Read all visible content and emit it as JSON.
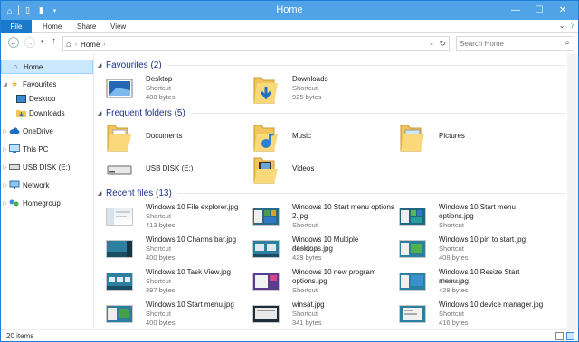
{
  "window": {
    "title": "Home",
    "controls": {
      "minimize": "—",
      "maximize": "☐",
      "close": "✕"
    }
  },
  "ribbon": {
    "tabs": [
      "File",
      "Home",
      "Share",
      "View"
    ]
  },
  "address": {
    "path_root": "⌂",
    "path_label": "Home",
    "search_placeholder": "Search Home"
  },
  "nav": {
    "items": [
      {
        "label": "Home",
        "icon": "home-icon"
      },
      {
        "label": "Favourites",
        "icon": "star-icon"
      },
      {
        "label": "Desktop",
        "icon": "desktop-icon"
      },
      {
        "label": "Downloads",
        "icon": "downloads-icon"
      },
      {
        "label": "OneDrive",
        "icon": "cloud-icon"
      },
      {
        "label": "This PC",
        "icon": "computer-icon"
      },
      {
        "label": "USB DISK (E:)",
        "icon": "usb-drive-icon"
      },
      {
        "label": "Network",
        "icon": "network-icon"
      },
      {
        "label": "Homegroup",
        "icon": "homegroup-icon"
      }
    ]
  },
  "groups": {
    "favourites": "Favourites (2)",
    "frequent": "Frequent folders (5)",
    "recent": "Recent files (13)"
  },
  "favourites": [
    {
      "name": "Desktop",
      "type": "Shortcut",
      "size": "488 bytes",
      "icon": "desktop-icon"
    },
    {
      "name": "Downloads",
      "type": "Shortcut",
      "size": "925 bytes",
      "icon": "downloads-folder-icon"
    }
  ],
  "frequent": [
    {
      "name": "Documents",
      "icon": "documents-folder-icon"
    },
    {
      "name": "Music",
      "icon": "music-folder-icon"
    },
    {
      "name": "Pictures",
      "icon": "pictures-folder-icon"
    },
    {
      "name": "USB DISK (E:)",
      "icon": "usb-drive-icon"
    },
    {
      "name": "Videos",
      "icon": "videos-folder-icon"
    }
  ],
  "recent": [
    {
      "name": "Windows 10 File explorer.jpg",
      "type": "Shortcut",
      "size": "413 bytes"
    },
    {
      "name": "Windows 10 Start menu options 2.jpg",
      "type": "Shortcut",
      "size": ""
    },
    {
      "name": "Windows 10 Start menu options.jpg",
      "type": "Shortcut",
      "size": ""
    },
    {
      "name": "Windows 10 Charms bar.jpg",
      "type": "Shortcut",
      "size": "400 bytes"
    },
    {
      "name": "Windows 10 Multiple desktops.jpg",
      "type": "Shortcut",
      "size": "429 bytes"
    },
    {
      "name": "Windows 10 pin to start.jpg",
      "type": "Shortcut",
      "size": "408 bytes"
    },
    {
      "name": "Windows 10 Task View.jpg",
      "type": "Shortcut",
      "size": "397 bytes"
    },
    {
      "name": "Windows 10 new program options.jpg",
      "type": "Shortcut",
      "size": ""
    },
    {
      "name": "Windows 10 Resize Start menu.jpg",
      "type": "Shortcut",
      "size": "429 bytes"
    },
    {
      "name": "Windows 10 Start menu.jpg",
      "type": "Shortcut",
      "size": "400 bytes"
    },
    {
      "name": "winsat.jpg",
      "type": "Shortcut",
      "size": "341 bytes"
    },
    {
      "name": "Windows 10 device manager.jpg",
      "type": "Shortcut",
      "size": "416 bytes"
    }
  ],
  "status": {
    "items": "20 items"
  }
}
